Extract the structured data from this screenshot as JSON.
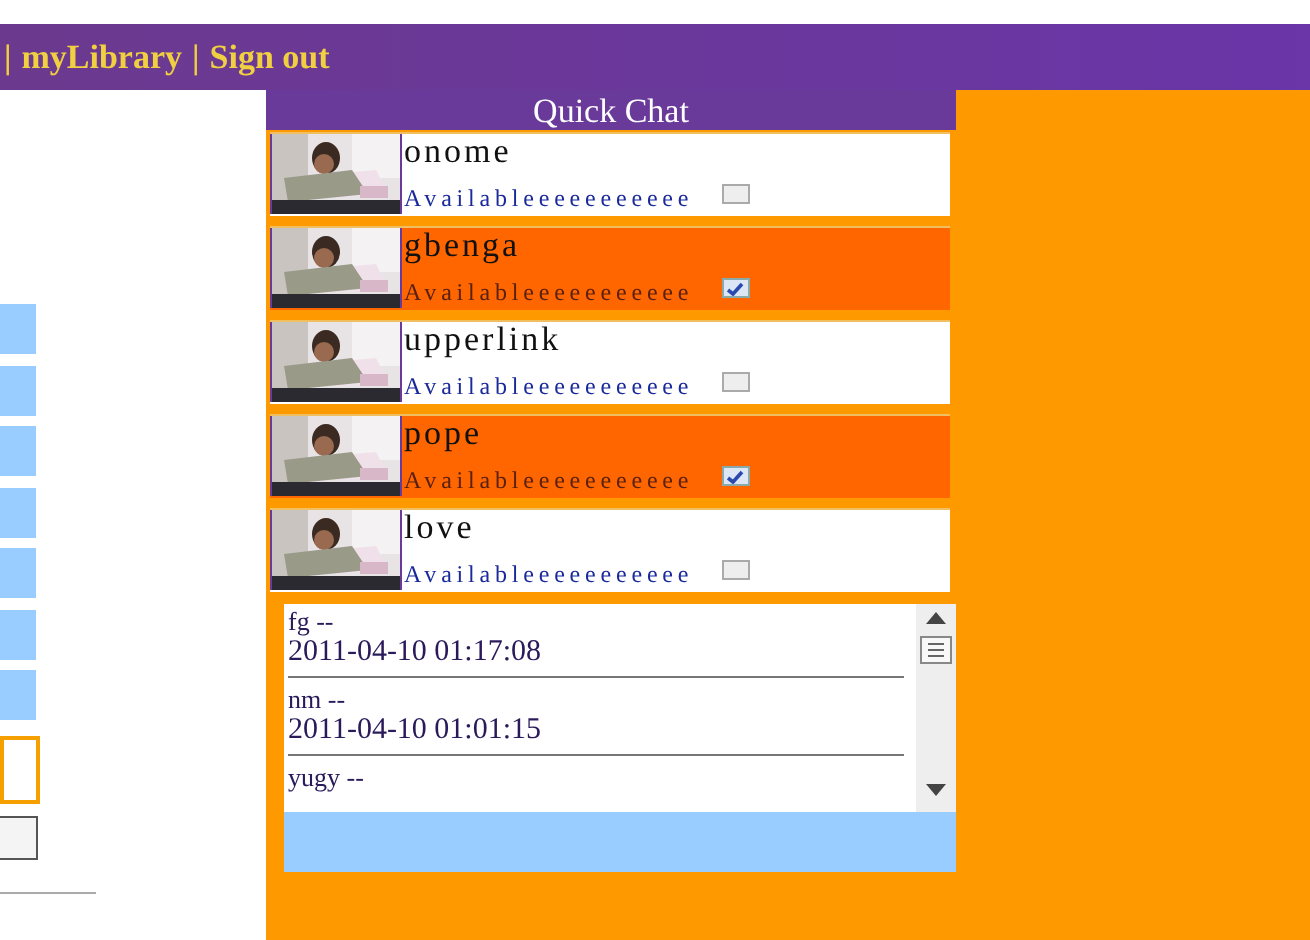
{
  "header": {
    "links": [
      {
        "kind": "separator",
        "label": "|"
      },
      {
        "kind": "link",
        "label": "myLibrary"
      },
      {
        "kind": "separator",
        "label": "|"
      },
      {
        "kind": "link",
        "label": "Sign out"
      }
    ]
  },
  "quick_chat": {
    "title": "Quick Chat",
    "contacts": [
      {
        "name": "onome",
        "status": "Availableeeeeeeeeee",
        "checked": false
      },
      {
        "name": "gbenga",
        "status": "Availableeeeeeeeeee",
        "checked": true
      },
      {
        "name": "upperlink",
        "status": "Availableeeeeeeeeee",
        "checked": false
      },
      {
        "name": "pope",
        "status": "Availableeeeeeeeeee",
        "checked": true
      },
      {
        "name": "love",
        "status": "Availableeeeeeeeeee",
        "checked": false
      }
    ],
    "messages": [
      {
        "sender": "fg --",
        "time": "2011-04-10 01:17:08"
      },
      {
        "sender": "nm --",
        "time": "2011-04-10 01:01:15"
      },
      {
        "sender": "yugy --"
      }
    ]
  }
}
